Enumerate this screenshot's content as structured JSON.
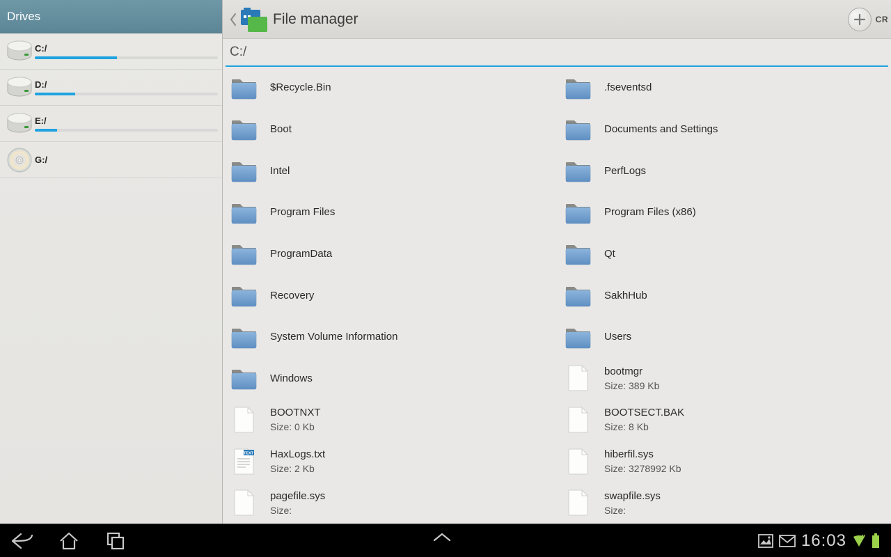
{
  "sidebar": {
    "title": "Drives",
    "drives": [
      {
        "label": "C:/",
        "type": "hdd",
        "used_pct": 45
      },
      {
        "label": "D:/",
        "type": "hdd",
        "used_pct": 22
      },
      {
        "label": "E:/",
        "type": "hdd",
        "used_pct": 12
      },
      {
        "label": "G:/",
        "type": "cd",
        "used_pct": 0
      }
    ]
  },
  "header": {
    "title": "File manager",
    "action_label": "CR"
  },
  "path": {
    "value": "C:/"
  },
  "size_prefix": "Size: ",
  "files_col1": [
    {
      "name": "$Recycle.Bin",
      "type": "folder"
    },
    {
      "name": "Boot",
      "type": "folder"
    },
    {
      "name": "Intel",
      "type": "folder"
    },
    {
      "name": "Program Files",
      "type": "folder"
    },
    {
      "name": "ProgramData",
      "type": "folder"
    },
    {
      "name": "Recovery",
      "type": "folder"
    },
    {
      "name": "System Volume Information",
      "type": "folder"
    },
    {
      "name": "Windows",
      "type": "folder"
    },
    {
      "name": "BOOTNXT",
      "type": "file",
      "size": "0 Kb"
    },
    {
      "name": "HaxLogs.txt",
      "type": "txt",
      "size": "2 Kb"
    },
    {
      "name": "pagefile.sys",
      "type": "file",
      "size": ""
    }
  ],
  "files_col2": [
    {
      "name": ".fseventsd",
      "type": "folder"
    },
    {
      "name": "Documents and Settings",
      "type": "folder"
    },
    {
      "name": "PerfLogs",
      "type": "folder"
    },
    {
      "name": "Program Files (x86)",
      "type": "folder"
    },
    {
      "name": "Qt",
      "type": "folder"
    },
    {
      "name": "SakhHub",
      "type": "folder"
    },
    {
      "name": "Users",
      "type": "folder"
    },
    {
      "name": "bootmgr",
      "type": "file",
      "size": "389 Kb"
    },
    {
      "name": "BOOTSECT.BAK",
      "type": "file",
      "size": "8 Kb"
    },
    {
      "name": "hiberfil.sys",
      "type": "file",
      "size": "3278992 Kb"
    },
    {
      "name": "swapfile.sys",
      "type": "file",
      "size": ""
    }
  ],
  "statusbar": {
    "time": "16:03"
  }
}
